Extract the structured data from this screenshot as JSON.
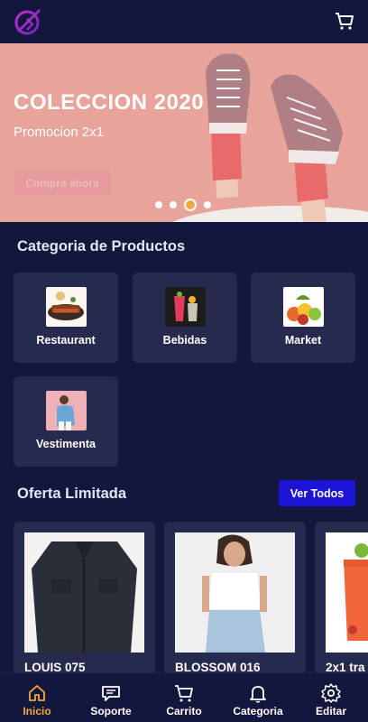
{
  "header": {
    "logo_icon": "brand-logo-icon",
    "cart_icon": "cart-icon"
  },
  "banner": {
    "title": "COLECCION 2020",
    "subtitle": "Promocion 2x1",
    "button": "Compra ahora",
    "dots": 4,
    "active_dot": 3
  },
  "categories": {
    "title": "Categoria de Productos",
    "items": [
      {
        "label": "Restaurant",
        "icon": "food-image"
      },
      {
        "label": "Bebidas",
        "icon": "drinks-image"
      },
      {
        "label": "Market",
        "icon": "fruits-image"
      },
      {
        "label": "Vestimenta",
        "icon": "clothing-image"
      }
    ]
  },
  "offers": {
    "title": "Oferta Limitada",
    "see_all": "Ver Todos",
    "products": [
      {
        "name": "LOUIS 075"
      },
      {
        "name": "BLOSSOM 016"
      },
      {
        "name": "2x1 tra"
      }
    ]
  },
  "nav": {
    "items": [
      {
        "label": "Inicio",
        "icon": "home-icon",
        "active": true
      },
      {
        "label": "Soporte",
        "icon": "chat-icon"
      },
      {
        "label": "Carrito",
        "icon": "cart-icon"
      },
      {
        "label": "Categoria",
        "icon": "bell-icon"
      },
      {
        "label": "Editar",
        "icon": "gear-icon"
      }
    ]
  },
  "colors": {
    "background": "#13173d",
    "card": "#262a4f",
    "accent": "#f2a93b",
    "primary_button": "#1d14d6",
    "banner_bg": "#e8a39b"
  }
}
